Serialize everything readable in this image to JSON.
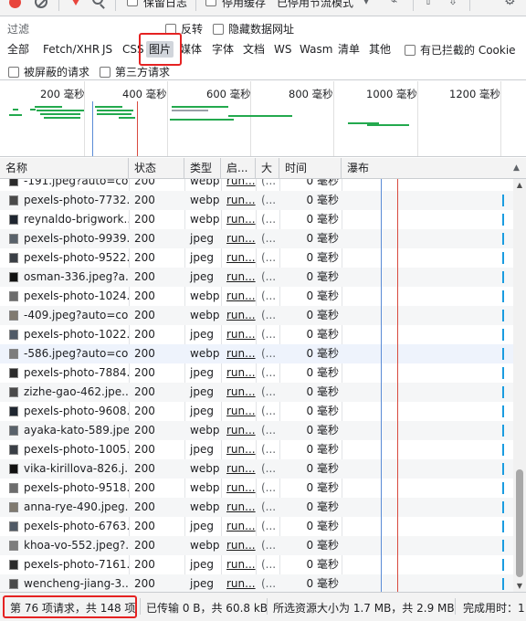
{
  "toolbar": {
    "preserve_log": "保留日志",
    "disable_cache": "停用缓存",
    "throttling": "已停用节流模式"
  },
  "filter": {
    "label": "过滤",
    "placeholder": "",
    "invert": "反转",
    "hide_data_urls": "隐藏数据网址"
  },
  "types": {
    "all": "全部",
    "fetch": "Fetch/XHR",
    "js": "JS",
    "css": "CSS",
    "img": "图片",
    "media": "媒体",
    "font": "字体",
    "doc": "文档",
    "ws": "WS",
    "wasm": "Wasm",
    "manifest": "清单",
    "other": "其他",
    "blocked_cookies": "有已拦截的 Cookie"
  },
  "options": {
    "blocked_requests": "被屏蔽的请求",
    "third_party": "第三方请求"
  },
  "overview": {
    "ticks": [
      "200 毫秒",
      "400 毫秒",
      "600 毫秒",
      "800 毫秒",
      "1000 毫秒",
      "1200 毫秒"
    ]
  },
  "columns": {
    "name": "名称",
    "status": "状态",
    "type": "类型",
    "initiator": "启...",
    "size": "大",
    "time": "时间",
    "waterfall": "瀑布"
  },
  "rows": [
    {
      "name": "-191.jpeg?auto=co...",
      "status": "200",
      "type": "webp",
      "initiator": "run...",
      "size": "(...",
      "time": "0 毫秒"
    },
    {
      "name": "pexels-photo-7732...",
      "status": "200",
      "type": "webp",
      "initiator": "run...",
      "size": "(...",
      "time": "0 毫秒"
    },
    {
      "name": "reynaldo-brigwork...",
      "status": "200",
      "type": "webp",
      "initiator": "run...",
      "size": "(...",
      "time": "0 毫秒"
    },
    {
      "name": "pexels-photo-9939...",
      "status": "200",
      "type": "jpeg",
      "initiator": "run...",
      "size": "(...",
      "time": "0 毫秒"
    },
    {
      "name": "pexels-photo-9522...",
      "status": "200",
      "type": "jpeg",
      "initiator": "run...",
      "size": "(...",
      "time": "0 毫秒"
    },
    {
      "name": "osman-336.jpeg?a...",
      "status": "200",
      "type": "jpeg",
      "initiator": "run...",
      "size": "(...",
      "time": "0 毫秒"
    },
    {
      "name": "pexels-photo-1024...",
      "status": "200",
      "type": "webp",
      "initiator": "run...",
      "size": "(...",
      "time": "0 毫秒"
    },
    {
      "name": "-409.jpeg?auto=co...",
      "status": "200",
      "type": "webp",
      "initiator": "run...",
      "size": "(...",
      "time": "0 毫秒"
    },
    {
      "name": "pexels-photo-1022...",
      "status": "200",
      "type": "jpeg",
      "initiator": "run...",
      "size": "(...",
      "time": "0 毫秒"
    },
    {
      "name": "-586.jpeg?auto=co...",
      "status": "200",
      "type": "webp",
      "initiator": "run...",
      "size": "(...",
      "time": "0 毫秒"
    },
    {
      "name": "pexels-photo-7884...",
      "status": "200",
      "type": "jpeg",
      "initiator": "run...",
      "size": "(...",
      "time": "0 毫秒"
    },
    {
      "name": "zizhe-gao-462.jpe...",
      "status": "200",
      "type": "jpeg",
      "initiator": "run...",
      "size": "(...",
      "time": "0 毫秒"
    },
    {
      "name": "pexels-photo-9608...",
      "status": "200",
      "type": "jpeg",
      "initiator": "run...",
      "size": "(...",
      "time": "0 毫秒"
    },
    {
      "name": "ayaka-kato-589.jpe...",
      "status": "200",
      "type": "webp",
      "initiator": "run...",
      "size": "(...",
      "time": "0 毫秒"
    },
    {
      "name": "pexels-photo-1005...",
      "status": "200",
      "type": "jpeg",
      "initiator": "run...",
      "size": "(...",
      "time": "0 毫秒"
    },
    {
      "name": "vika-kirillova-826.j...",
      "status": "200",
      "type": "webp",
      "initiator": "run...",
      "size": "(...",
      "time": "0 毫秒"
    },
    {
      "name": "pexels-photo-9518...",
      "status": "200",
      "type": "webp",
      "initiator": "run...",
      "size": "(...",
      "time": "0 毫秒"
    },
    {
      "name": "anna-rye-490.jpeg...",
      "status": "200",
      "type": "webp",
      "initiator": "run...",
      "size": "(...",
      "time": "0 毫秒"
    },
    {
      "name": "pexels-photo-6763...",
      "status": "200",
      "type": "jpeg",
      "initiator": "run...",
      "size": "(...",
      "time": "0 毫秒"
    },
    {
      "name": "khoa-vo-552.jpeg?...",
      "status": "200",
      "type": "webp",
      "initiator": "run...",
      "size": "(...",
      "time": "0 毫秒"
    },
    {
      "name": "pexels-photo-7161...",
      "status": "200",
      "type": "jpeg",
      "initiator": "run...",
      "size": "(...",
      "time": "0 毫秒"
    },
    {
      "name": "wencheng-jiang-3...",
      "status": "200",
      "type": "jpeg",
      "initiator": "run...",
      "size": "(...",
      "time": "0 毫秒"
    }
  ],
  "status_bar": {
    "requests": "第 76 项请求，共 148 项",
    "transferred": "已传输 0 B，共 60.8 kB",
    "resources": "所选资源大小为 1.7 MB，共 2.9 MB",
    "finish": "完成用时：1"
  },
  "colors": {
    "highlight": "#e52222",
    "dom_content_loaded": "#5a8bd6",
    "load": "#d84a3f"
  }
}
